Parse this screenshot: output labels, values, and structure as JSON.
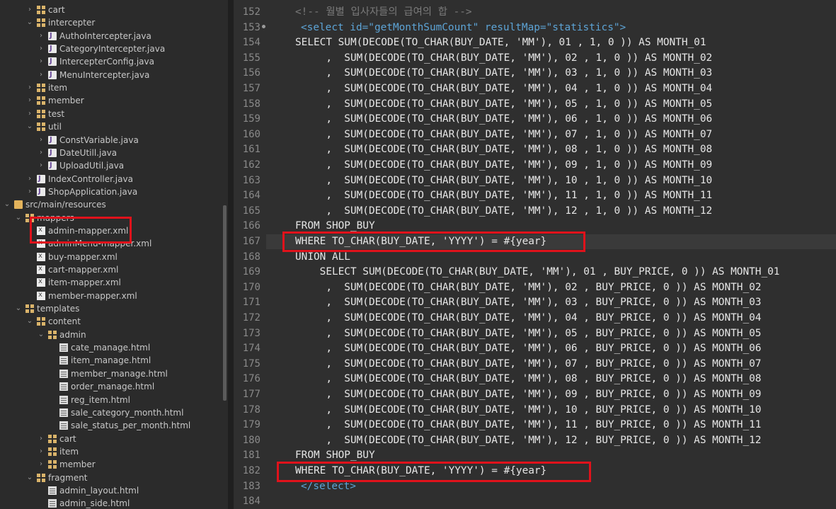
{
  "explorer": {
    "items": [
      {
        "label": "cart",
        "twisty": "›",
        "icon": "package-icon"
      },
      {
        "label": "intercepter",
        "twisty": "⌄",
        "icon": "package-icon"
      },
      {
        "label": "AuthoIntercepter.java",
        "twisty": "›",
        "icon": "java-file-icon"
      },
      {
        "label": "CategoryIntercepter.java",
        "twisty": "›",
        "icon": "java-file-icon"
      },
      {
        "label": "IntercepterConfig.java",
        "twisty": "›",
        "icon": "java-file-icon"
      },
      {
        "label": "MenuIntercepter.java",
        "twisty": "›",
        "icon": "java-file-icon"
      },
      {
        "label": "item",
        "twisty": "›",
        "icon": "package-icon"
      },
      {
        "label": "member",
        "twisty": "›",
        "icon": "package-icon"
      },
      {
        "label": "test",
        "twisty": "›",
        "icon": "package-icon"
      },
      {
        "label": "util",
        "twisty": "⌄",
        "icon": "package-icon"
      },
      {
        "label": "ConstVariable.java",
        "twisty": "›",
        "icon": "java-file-icon"
      },
      {
        "label": "DateUtill.java",
        "twisty": "›",
        "icon": "java-file-icon"
      },
      {
        "label": "UploadUtil.java",
        "twisty": "›",
        "icon": "java-file-icon"
      },
      {
        "label": "IndexController.java",
        "twisty": "›",
        "icon": "java-file-icon"
      },
      {
        "label": "ShopApplication.java",
        "twisty": "›",
        "icon": "java-file-icon"
      },
      {
        "label": "src/main/resources",
        "twisty": "⌄",
        "icon": "source-folder-icon"
      },
      {
        "label": "mappers",
        "twisty": "⌄",
        "icon": "package-icon"
      },
      {
        "label": "admin-mapper.xml",
        "twisty": "",
        "icon": "xml-file-icon"
      },
      {
        "label": "adminMenu-mapper.xml",
        "twisty": "",
        "icon": "xml-file-icon"
      },
      {
        "label": "buy-mapper.xml",
        "twisty": "",
        "icon": "xml-file-icon"
      },
      {
        "label": "cart-mapper.xml",
        "twisty": "",
        "icon": "xml-file-icon"
      },
      {
        "label": "item-mapper.xml",
        "twisty": "",
        "icon": "xml-file-icon"
      },
      {
        "label": "member-mapper.xml",
        "twisty": "",
        "icon": "xml-file-icon"
      },
      {
        "label": "templates",
        "twisty": "⌄",
        "icon": "package-icon"
      },
      {
        "label": "content",
        "twisty": "⌄",
        "icon": "package-icon"
      },
      {
        "label": "admin",
        "twisty": "⌄",
        "icon": "package-icon"
      },
      {
        "label": "cate_manage.html",
        "twisty": "",
        "icon": "html-file-icon"
      },
      {
        "label": "item_manage.html",
        "twisty": "",
        "icon": "html-file-icon"
      },
      {
        "label": "member_manage.html",
        "twisty": "",
        "icon": "html-file-icon"
      },
      {
        "label": "order_manage.html",
        "twisty": "",
        "icon": "html-file-icon"
      },
      {
        "label": "reg_item.html",
        "twisty": "",
        "icon": "html-file-icon"
      },
      {
        "label": "sale_category_month.html",
        "twisty": "",
        "icon": "html-file-icon"
      },
      {
        "label": "sale_status_per_month.html",
        "twisty": "",
        "icon": "html-file-icon"
      },
      {
        "label": "cart",
        "twisty": "›",
        "icon": "package-icon"
      },
      {
        "label": "item",
        "twisty": "›",
        "icon": "package-icon"
      },
      {
        "label": "member",
        "twisty": "›",
        "icon": "package-icon"
      },
      {
        "label": "fragment",
        "twisty": "⌄",
        "icon": "package-icon"
      },
      {
        "label": "admin_layout.html",
        "twisty": "",
        "icon": "html-file-icon"
      },
      {
        "label": "admin_side.html",
        "twisty": "",
        "icon": "html-file-icon"
      }
    ]
  },
  "editor": {
    "lines": [
      {
        "num": "152",
        "text": "<!-- 월별 입사자들의 급여의 합 -->"
      },
      {
        "num": "153",
        "text": "<select id=\"getMonthSumCount\" resultMap=\"statistics\">"
      },
      {
        "num": "154",
        "text": "SELECT SUM(DECODE(TO_CHAR(BUY_DATE, 'MM'), 01 , 1, 0 )) AS MONTH_01"
      },
      {
        "num": "155",
        "text": "     ,  SUM(DECODE(TO_CHAR(BUY_DATE, 'MM'), 02 , 1, 0 )) AS MONTH_02"
      },
      {
        "num": "156",
        "text": "     ,  SUM(DECODE(TO_CHAR(BUY_DATE, 'MM'), 03 , 1, 0 )) AS MONTH_03"
      },
      {
        "num": "157",
        "text": "     ,  SUM(DECODE(TO_CHAR(BUY_DATE, 'MM'), 04 , 1, 0 )) AS MONTH_04"
      },
      {
        "num": "158",
        "text": "     ,  SUM(DECODE(TO_CHAR(BUY_DATE, 'MM'), 05 , 1, 0 )) AS MONTH_05"
      },
      {
        "num": "159",
        "text": "     ,  SUM(DECODE(TO_CHAR(BUY_DATE, 'MM'), 06 , 1, 0 )) AS MONTH_06"
      },
      {
        "num": "160",
        "text": "     ,  SUM(DECODE(TO_CHAR(BUY_DATE, 'MM'), 07 , 1, 0 )) AS MONTH_07"
      },
      {
        "num": "161",
        "text": "     ,  SUM(DECODE(TO_CHAR(BUY_DATE, 'MM'), 08 , 1, 0 )) AS MONTH_08"
      },
      {
        "num": "162",
        "text": "     ,  SUM(DECODE(TO_CHAR(BUY_DATE, 'MM'), 09 , 1, 0 )) AS MONTH_09"
      },
      {
        "num": "163",
        "text": "     ,  SUM(DECODE(TO_CHAR(BUY_DATE, 'MM'), 10 , 1, 0 )) AS MONTH_10"
      },
      {
        "num": "164",
        "text": "     ,  SUM(DECODE(TO_CHAR(BUY_DATE, 'MM'), 11 , 1, 0 )) AS MONTH_11"
      },
      {
        "num": "165",
        "text": "     ,  SUM(DECODE(TO_CHAR(BUY_DATE, 'MM'), 12 , 1, 0 )) AS MONTH_12"
      },
      {
        "num": "166",
        "text": "FROM SHOP_BUY"
      },
      {
        "num": "167",
        "text": "WHERE TO_CHAR(BUY_DATE, 'YYYY') = #{year}"
      },
      {
        "num": "168",
        "text": "UNION ALL"
      },
      {
        "num": "169",
        "text": "    SELECT SUM(DECODE(TO_CHAR(BUY_DATE, 'MM'), 01 , BUY_PRICE, 0 )) AS MONTH_01"
      },
      {
        "num": "170",
        "text": "     ,  SUM(DECODE(TO_CHAR(BUY_DATE, 'MM'), 02 , BUY_PRICE, 0 )) AS MONTH_02"
      },
      {
        "num": "171",
        "text": "     ,  SUM(DECODE(TO_CHAR(BUY_DATE, 'MM'), 03 , BUY_PRICE, 0 )) AS MONTH_03"
      },
      {
        "num": "172",
        "text": "     ,  SUM(DECODE(TO_CHAR(BUY_DATE, 'MM'), 04 , BUY_PRICE, 0 )) AS MONTH_04"
      },
      {
        "num": "173",
        "text": "     ,  SUM(DECODE(TO_CHAR(BUY_DATE, 'MM'), 05 , BUY_PRICE, 0 )) AS MONTH_05"
      },
      {
        "num": "174",
        "text": "     ,  SUM(DECODE(TO_CHAR(BUY_DATE, 'MM'), 06 , BUY_PRICE, 0 )) AS MONTH_06"
      },
      {
        "num": "175",
        "text": "     ,  SUM(DECODE(TO_CHAR(BUY_DATE, 'MM'), 07 , BUY_PRICE, 0 )) AS MONTH_07"
      },
      {
        "num": "176",
        "text": "     ,  SUM(DECODE(TO_CHAR(BUY_DATE, 'MM'), 08 , BUY_PRICE, 0 )) AS MONTH_08"
      },
      {
        "num": "177",
        "text": "     ,  SUM(DECODE(TO_CHAR(BUY_DATE, 'MM'), 09 , BUY_PRICE, 0 )) AS MONTH_09"
      },
      {
        "num": "178",
        "text": "     ,  SUM(DECODE(TO_CHAR(BUY_DATE, 'MM'), 10 , BUY_PRICE, 0 )) AS MONTH_10"
      },
      {
        "num": "179",
        "text": "     ,  SUM(DECODE(TO_CHAR(BUY_DATE, 'MM'), 11 , BUY_PRICE, 0 )) AS MONTH_11"
      },
      {
        "num": "180",
        "text": "     ,  SUM(DECODE(TO_CHAR(BUY_DATE, 'MM'), 12 , BUY_PRICE, 0 )) AS MONTH_12"
      },
      {
        "num": "181",
        "text": "FROM SHOP_BUY"
      },
      {
        "num": "182",
        "text": "WHERE TO_CHAR(BUY_DATE, 'YYYY') = #{year}"
      },
      {
        "num": "183",
        "text": "</select>"
      },
      {
        "num": "184",
        "text": ""
      }
    ]
  },
  "colors": {
    "highlight_box": "#e0121b",
    "tag": "#5da4d6",
    "attr": "#9fd05a",
    "attr_value": "#c9c9ff",
    "comment": "#7a7a7a"
  }
}
